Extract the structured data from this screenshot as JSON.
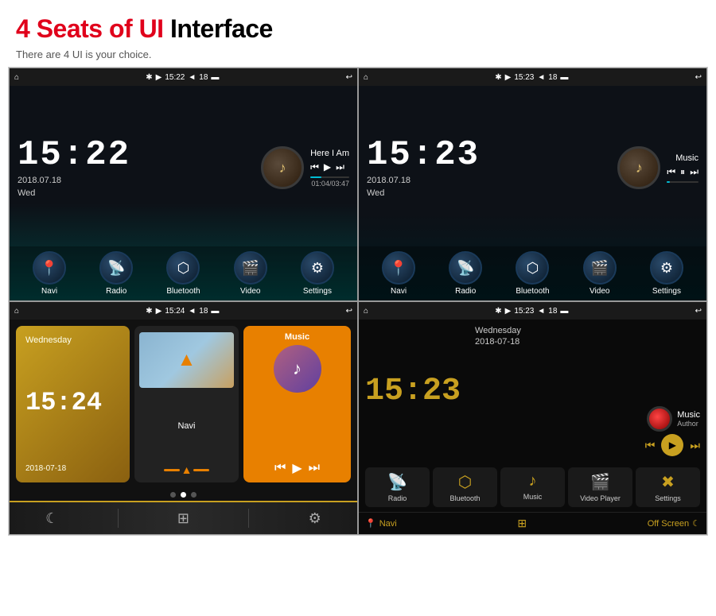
{
  "header": {
    "title_red": "4 Seats of UI",
    "title_black": "Interface",
    "subtitle": "There are 4 UI is your choice."
  },
  "ui1": {
    "status": {
      "bluetooth": "✱",
      "signal": "▶",
      "time": "15:22",
      "battery": "18",
      "screen": "▬",
      "back": "↩"
    },
    "clock": {
      "time": "15:22",
      "date": "2018.07.18",
      "day": "Wed"
    },
    "music": {
      "song": "Here I Am",
      "current": "01:04",
      "total": "03:47",
      "progress": 28
    },
    "apps": [
      {
        "label": "Navi",
        "icon": "📍"
      },
      {
        "label": "Radio",
        "icon": "📡"
      },
      {
        "label": "Bluetooth",
        "icon": "🔷"
      },
      {
        "label": "Video",
        "icon": "🎬"
      },
      {
        "label": "Settings",
        "icon": "⚙"
      }
    ]
  },
  "ui2": {
    "status": {
      "time": "15:23",
      "battery": "18"
    },
    "clock": {
      "time": "15:23",
      "date": "2018.07.18",
      "day": "Wed"
    },
    "music": {
      "song": "Music",
      "progress": 10
    },
    "apps": [
      {
        "label": "Navi",
        "icon": "📍"
      },
      {
        "label": "Radio",
        "icon": "📡"
      },
      {
        "label": "Bluetooth",
        "icon": "🔷"
      },
      {
        "label": "Video",
        "icon": "🎬"
      },
      {
        "label": "Settings",
        "icon": "⚙"
      }
    ]
  },
  "ui3": {
    "status": {
      "time": "15:24",
      "battery": "18"
    },
    "clock": {
      "time": "15:24",
      "date": "2018-07-18",
      "day": "Wednesday"
    },
    "taskbar": [
      {
        "icon": "☾",
        "label": "sleep"
      },
      {
        "icon": "⊞",
        "label": "grid"
      },
      {
        "icon": "⚙",
        "label": "settings"
      }
    ]
  },
  "ui4": {
    "status": {
      "time": "15:23",
      "battery": "18"
    },
    "clock": {
      "time": "15:23"
    },
    "date": {
      "day": "Wednesday",
      "date": "2018-07-18"
    },
    "music": {
      "title": "Music",
      "author": "Author"
    },
    "apps": [
      {
        "label": "Radio",
        "icon": "📡"
      },
      {
        "label": "Bluetooth",
        "icon": "🔷"
      },
      {
        "label": "Music",
        "icon": "♪"
      },
      {
        "label": "Video Player",
        "icon": "🎬"
      },
      {
        "label": "Settings",
        "icon": "✖"
      }
    ],
    "bottom": [
      {
        "label": "Navi",
        "icon": "📍"
      },
      {
        "label": "Off Screen",
        "icon": "☾"
      }
    ]
  }
}
